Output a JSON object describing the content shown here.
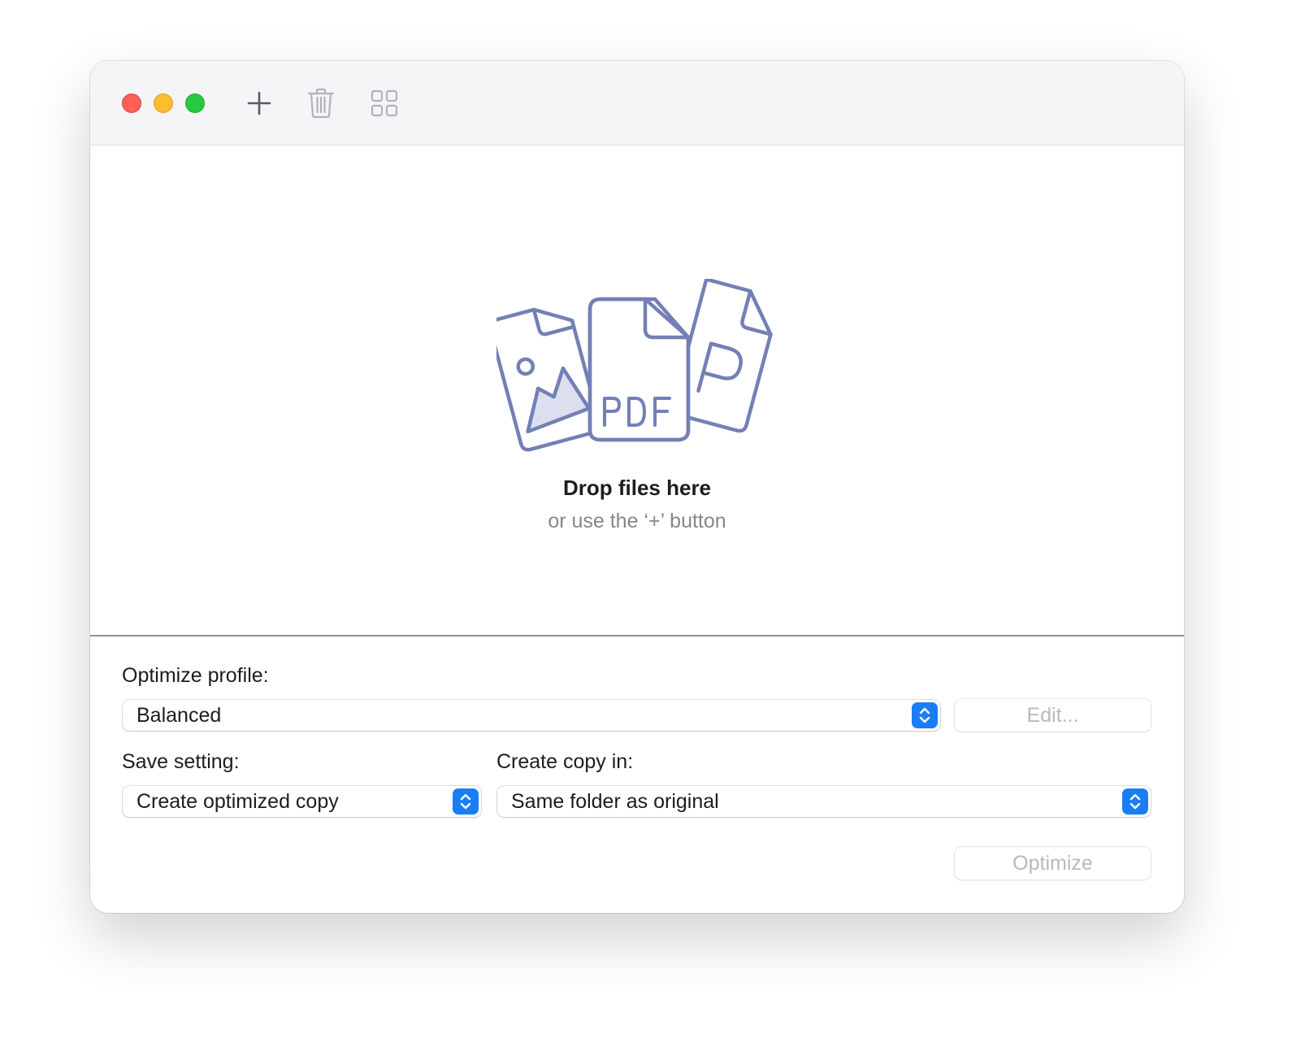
{
  "window": {
    "toolbar": {
      "add_icon": "plus-icon",
      "trash_icon": "trash-icon",
      "grid_icon": "grid-icon"
    },
    "traffic_lights": {
      "close_color": "#fe5f57",
      "minimize_color": "#febc2e",
      "zoom_color": "#28c840"
    }
  },
  "dropzone": {
    "illustration": "image-pdf-document-illustration",
    "pdf_text": "PDF",
    "title": "Drop files here",
    "subtitle": "or use the ‘+’ button"
  },
  "settings": {
    "profile_label": "Optimize profile:",
    "profile_value": "Balanced",
    "edit_button": "Edit...",
    "save_label": "Save setting:",
    "save_value": "Create optimized copy",
    "copy_label": "Create copy in:",
    "copy_value": "Same folder as original",
    "optimize_button": "Optimize"
  },
  "colors": {
    "accent": "#1a7df5",
    "illustration_stroke": "#7380b5",
    "illustration_fill": "#dcdff0",
    "disabled_text": "#b9b9be"
  }
}
